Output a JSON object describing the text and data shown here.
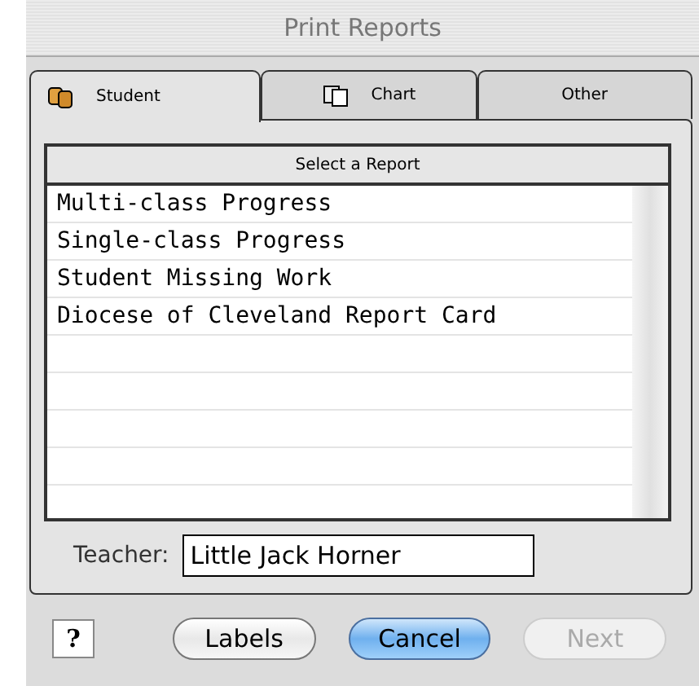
{
  "window": {
    "title": "Print Reports"
  },
  "tabs": [
    {
      "label": "Student",
      "kind": "people",
      "selected": true
    },
    {
      "label": "Chart",
      "kind": "pages",
      "selected": false
    },
    {
      "label": "Other",
      "kind": "plain",
      "selected": false
    }
  ],
  "report_list": {
    "header": "Select a Report",
    "items": [
      {
        "label": "Multi-class Progress",
        "selected": false
      },
      {
        "label": "Single-class Progress",
        "selected": false
      },
      {
        "label": "Student Missing Work",
        "selected": false
      },
      {
        "label": "Diocese of Cleveland Report Card",
        "selected": false
      }
    ]
  },
  "teacher": {
    "label": "Teacher:",
    "value": "Little Jack Horner"
  },
  "help_button": {
    "label": "?"
  },
  "buttons": [
    {
      "label": "Labels",
      "default": false,
      "disabled": false
    },
    {
      "label": "Cancel",
      "default": true,
      "disabled": false
    },
    {
      "label": "Next",
      "default": false,
      "disabled": true
    }
  ]
}
